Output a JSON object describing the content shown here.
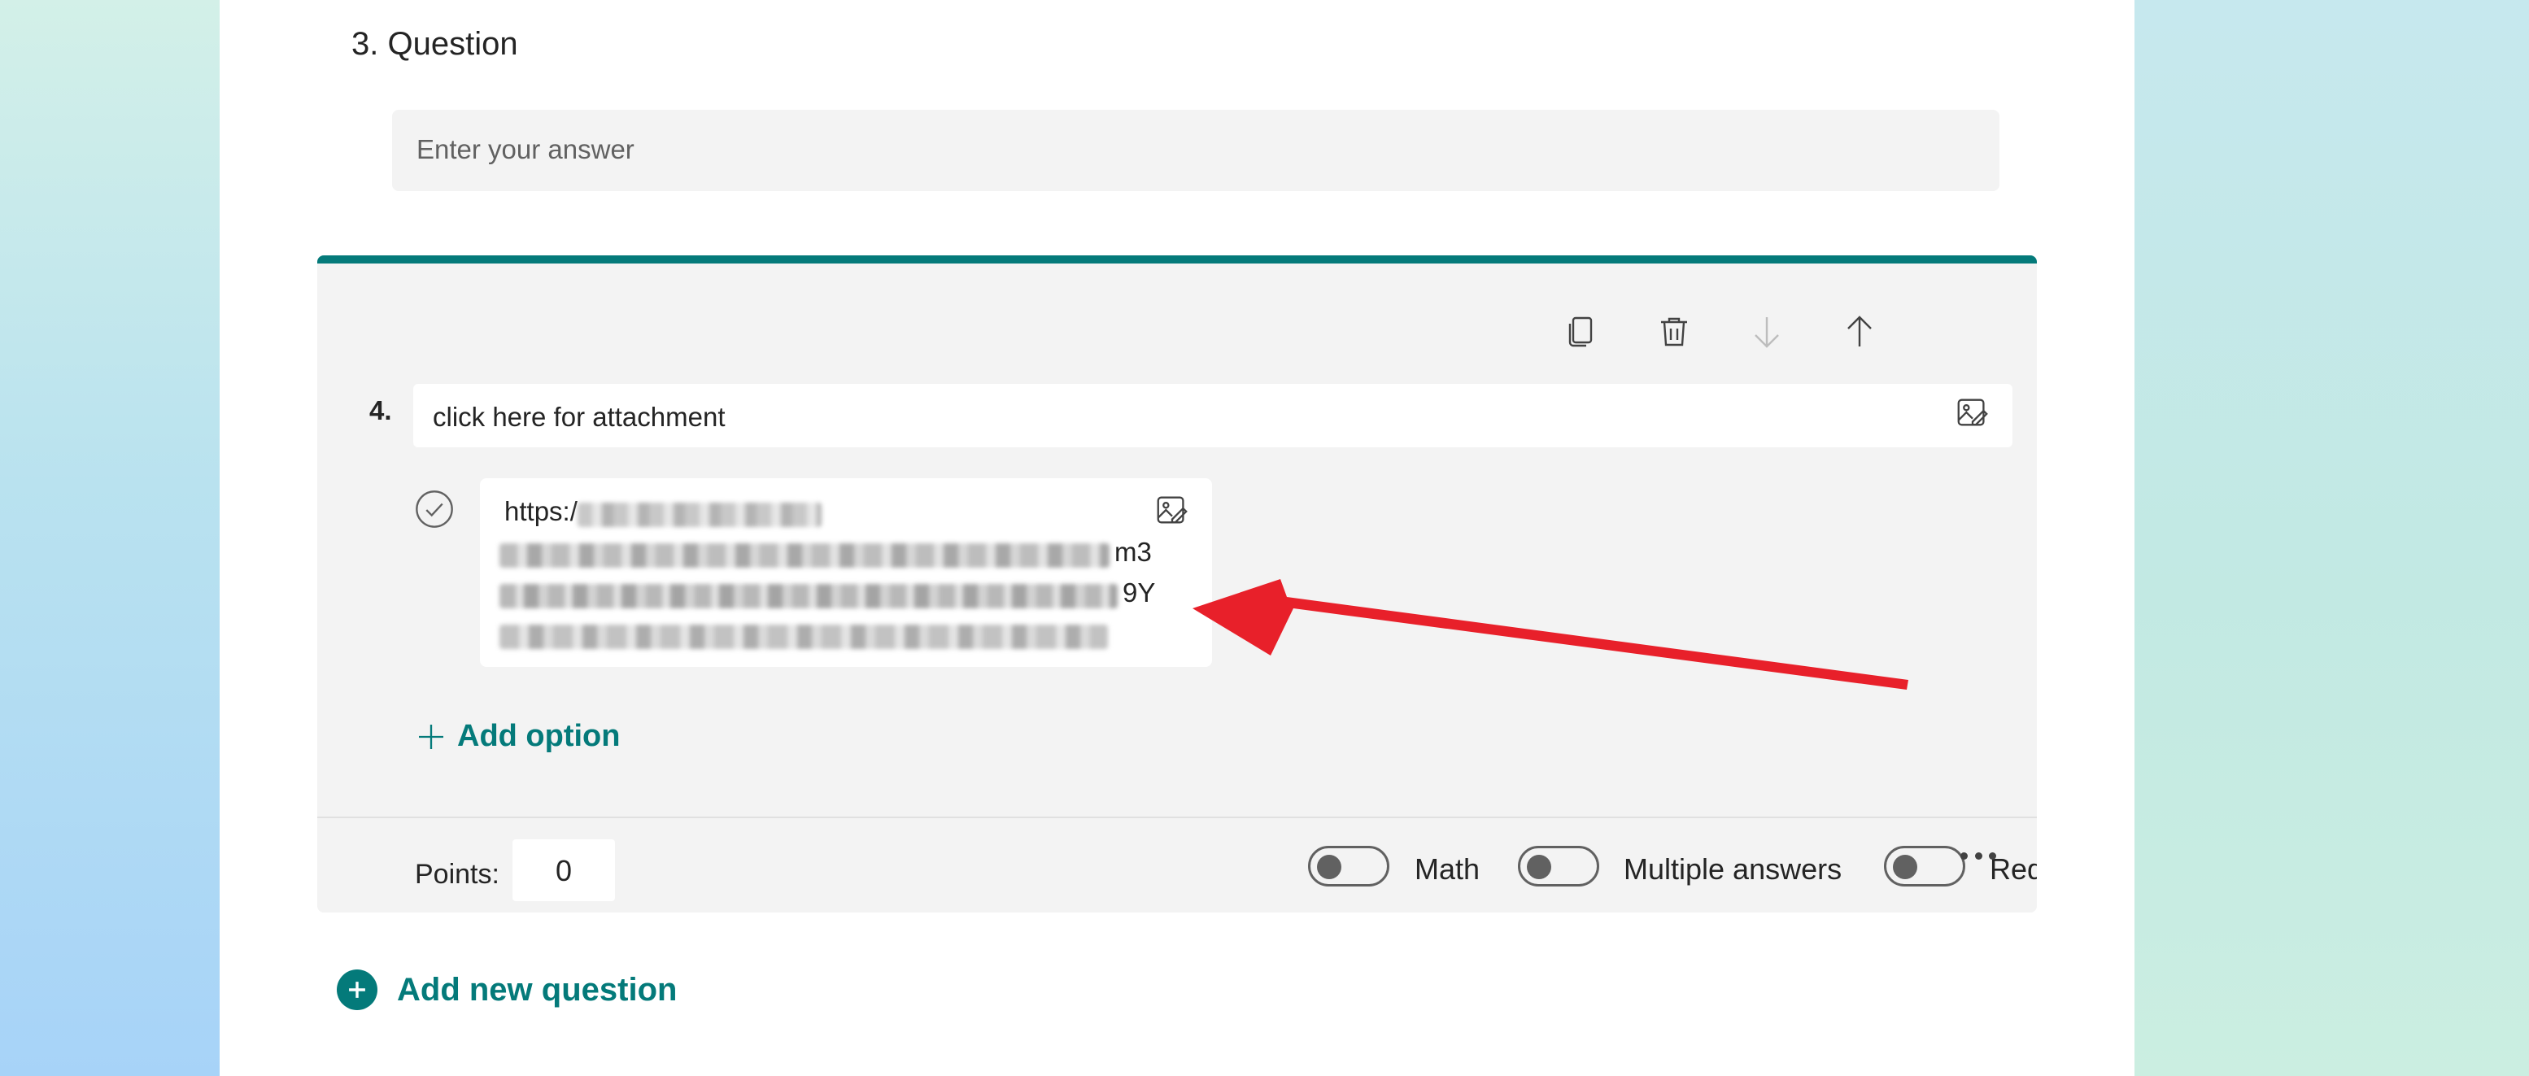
{
  "question3": {
    "title": "3. Question",
    "answer_placeholder": "Enter your answer"
  },
  "question4": {
    "number": "4.",
    "title": "click here for attachment",
    "option": {
      "line1_start": "https:/",
      "line2_end": "m3",
      "line3_end": "9Y"
    },
    "add_option_label": "Add option",
    "points_label": "Points:",
    "points_value": "0",
    "toggles": [
      {
        "label": "Math",
        "on": false
      },
      {
        "label": "Multiple answers",
        "on": false
      },
      {
        "label": "Required",
        "on": false
      }
    ],
    "toolbar_icons": [
      "copy-icon",
      "trash-icon",
      "arrow-down-icon",
      "arrow-up-icon"
    ]
  },
  "add_question_label": "Add new question",
  "colors": {
    "accent": "#047a7a",
    "annotation_arrow": "#e8202a"
  }
}
